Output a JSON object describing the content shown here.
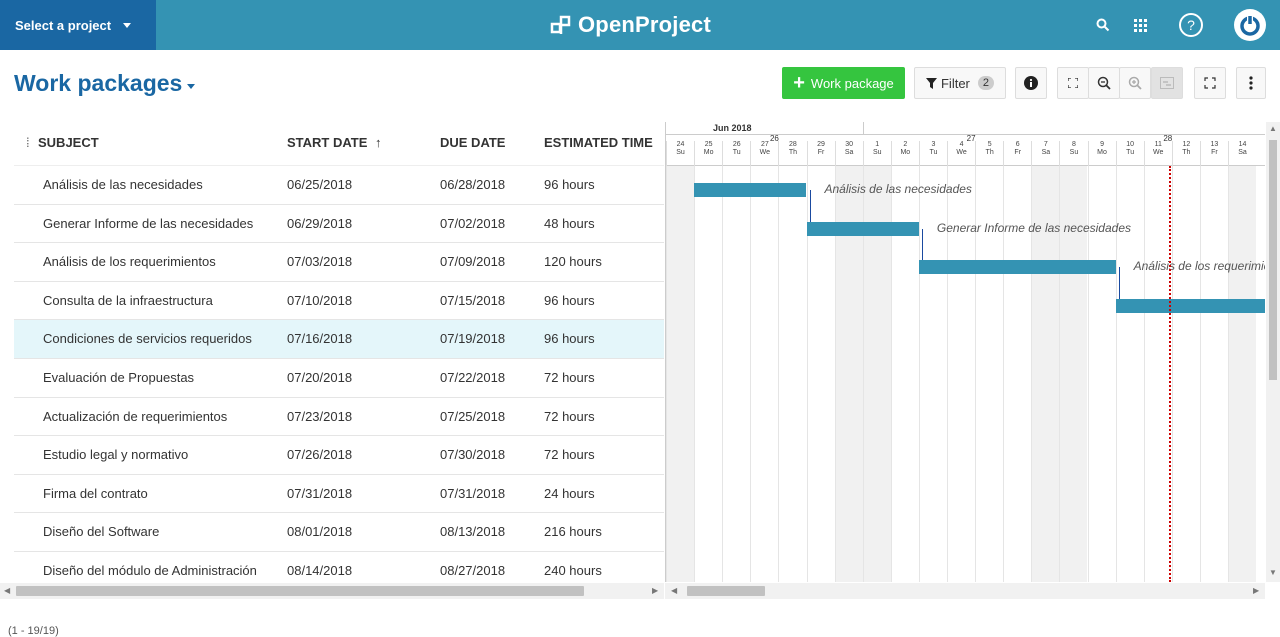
{
  "header": {
    "project_select": "Select a project",
    "logo_text": "OpenProject"
  },
  "toolbar": {
    "title": "Work packages",
    "add_label": "Work package",
    "filter_label": "Filter",
    "filter_count": "2"
  },
  "table": {
    "columns": [
      "SUBJECT",
      "START DATE",
      "DUE DATE",
      "ESTIMATED TIME"
    ],
    "rows": [
      {
        "subject": "Análisis de las necesidades",
        "start": "06/25/2018",
        "due": "06/28/2018",
        "est": "96 hours"
      },
      {
        "subject": "Generar Informe de las necesidades",
        "start": "06/29/2018",
        "due": "07/02/2018",
        "est": "48 hours"
      },
      {
        "subject": "Análisis de los requerimientos",
        "start": "07/03/2018",
        "due": "07/09/2018",
        "est": "120 hours"
      },
      {
        "subject": "Consulta de la infraestructura",
        "start": "07/10/2018",
        "due": "07/15/2018",
        "est": "96 hours"
      },
      {
        "subject": "Condiciones de servicios requeridos",
        "start": "07/16/2018",
        "due": "07/19/2018",
        "est": "96 hours"
      },
      {
        "subject": "Evaluación de Propuestas",
        "start": "07/20/2018",
        "due": "07/22/2018",
        "est": "72 hours"
      },
      {
        "subject": "Actualización de requerimientos",
        "start": "07/23/2018",
        "due": "07/25/2018",
        "est": "72 hours"
      },
      {
        "subject": "Estudio legal y normativo",
        "start": "07/26/2018",
        "due": "07/30/2018",
        "est": "72 hours"
      },
      {
        "subject": "Firma del contrato",
        "start": "07/31/2018",
        "due": "07/31/2018",
        "est": "24 hours"
      },
      {
        "subject": "Diseño del Software",
        "start": "08/01/2018",
        "due": "08/13/2018",
        "est": "216 hours"
      },
      {
        "subject": "Diseño del módulo de Administración",
        "start": "08/14/2018",
        "due": "08/27/2018",
        "est": "240 hours"
      }
    ]
  },
  "status": "(1 - 19/19)",
  "gantt": {
    "month": "Jun 2018",
    "weeks": [
      "26",
      "27",
      "28"
    ],
    "days": [
      {
        "n": "24",
        "d": "Su"
      },
      {
        "n": "25",
        "d": "Mo"
      },
      {
        "n": "26",
        "d": "Tu"
      },
      {
        "n": "27",
        "d": "We"
      },
      {
        "n": "28",
        "d": "Th"
      },
      {
        "n": "29",
        "d": "Fr"
      },
      {
        "n": "30",
        "d": "Sa"
      },
      {
        "n": "1",
        "d": "Su"
      },
      {
        "n": "2",
        "d": "Mo"
      },
      {
        "n": "3",
        "d": "Tu"
      },
      {
        "n": "4",
        "d": "We"
      },
      {
        "n": "5",
        "d": "Th"
      },
      {
        "n": "6",
        "d": "Fr"
      },
      {
        "n": "7",
        "d": "Sa"
      },
      {
        "n": "8",
        "d": "Su"
      },
      {
        "n": "9",
        "d": "Mo"
      },
      {
        "n": "10",
        "d": "Tu"
      },
      {
        "n": "11",
        "d": "We"
      },
      {
        "n": "12",
        "d": "Th"
      },
      {
        "n": "13",
        "d": "Fr"
      },
      {
        "n": "14",
        "d": "Sa"
      }
    ],
    "bar_labels": [
      "Análisis de las necesidades",
      "Generar Informe de las necesidades",
      "Análisis de los requerimien"
    ]
  }
}
